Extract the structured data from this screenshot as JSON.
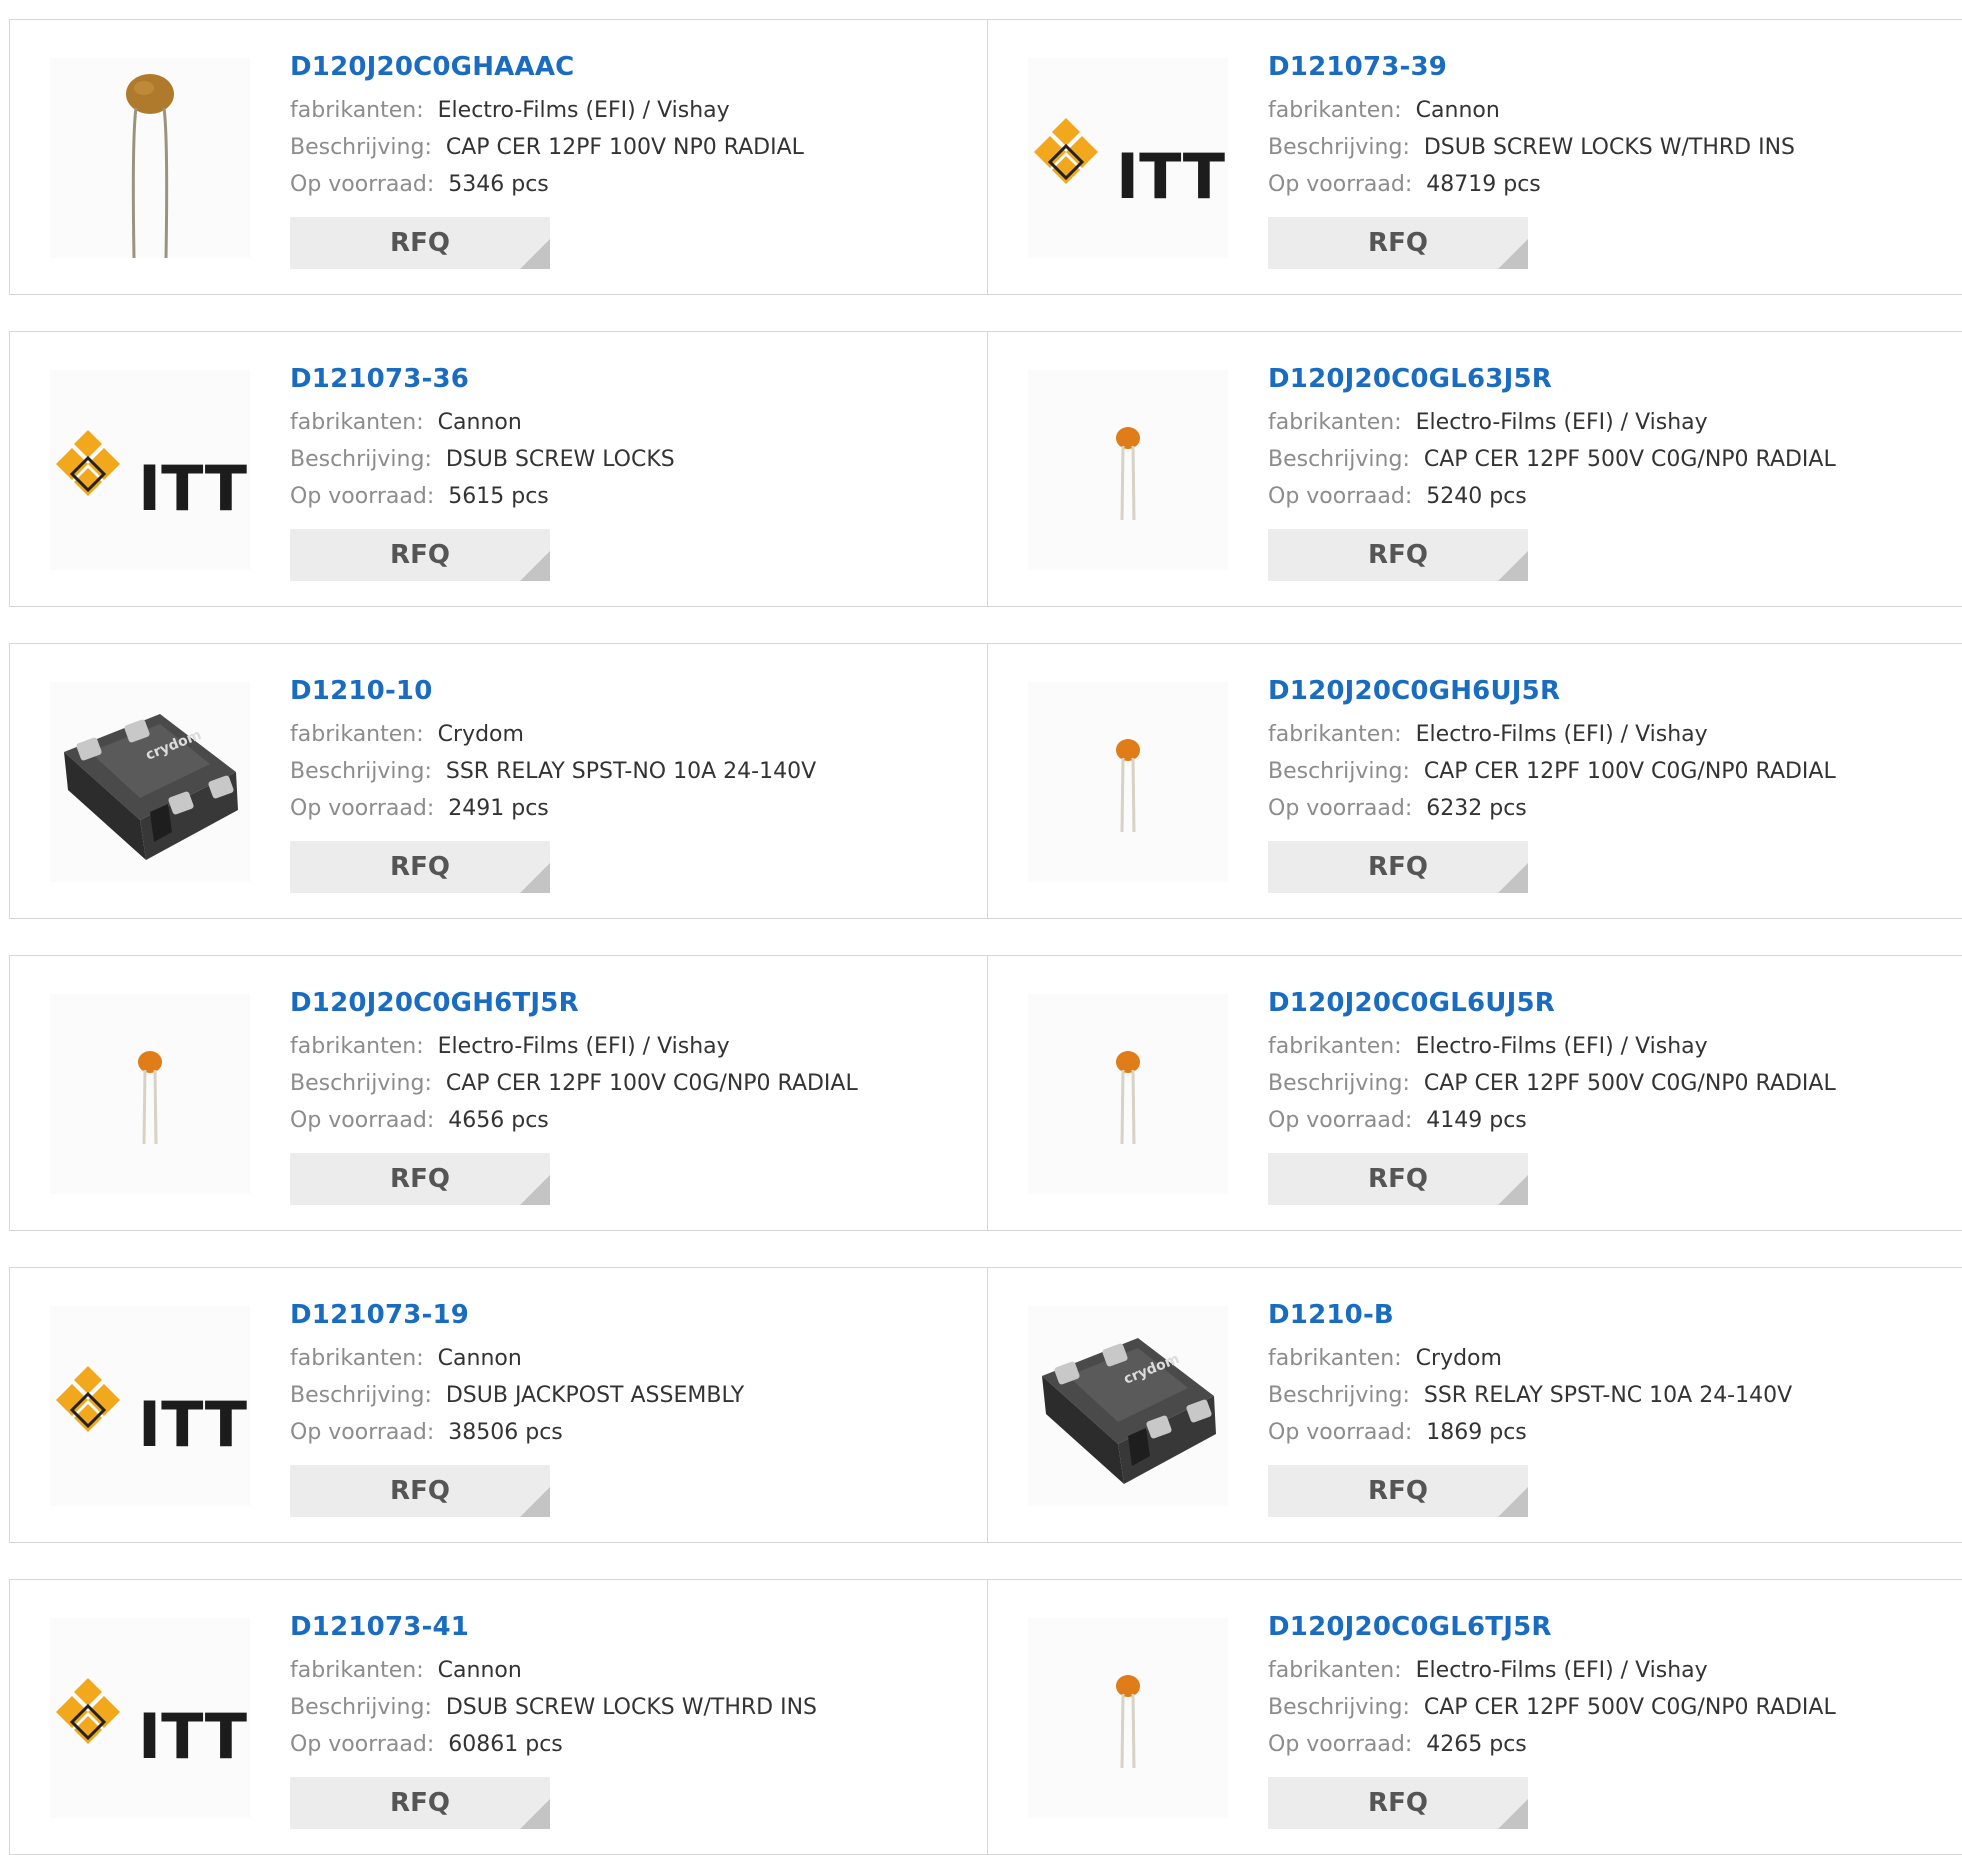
{
  "labels": {
    "manufacturer": "fabrikanten:",
    "description": "Beschrijving:",
    "stock": "Op voorraad:",
    "rfq": "RFQ"
  },
  "products": [
    {
      "pn": "D120J20C0GHAAAC",
      "mfr": "Electro-Films (EFI) / Vishay",
      "desc": "CAP CER 12PF 100V NP0 RADIAL",
      "stock": "5346 pcs",
      "image": "capacitor-large"
    },
    {
      "pn": "D121073-39",
      "mfr": "Cannon",
      "desc": "DSUB SCREW LOCKS W/THRD INS",
      "stock": "48719 pcs",
      "image": "itt-logo"
    },
    {
      "pn": "D121073-36",
      "mfr": "Cannon",
      "desc": "DSUB SCREW LOCKS",
      "stock": "5615 pcs",
      "image": "itt-logo"
    },
    {
      "pn": "D120J20C0GL63J5R",
      "mfr": "Electro-Films (EFI) / Vishay",
      "desc": "CAP CER 12PF 500V C0G/NP0 RADIAL",
      "stock": "5240 pcs",
      "image": "capacitor-small"
    },
    {
      "pn": "D1210-10",
      "mfr": "Crydom",
      "desc": "SSR RELAY SPST-NO 10A 24-140V",
      "stock": "2491 pcs",
      "image": "relay"
    },
    {
      "pn": "D120J20C0GH6UJ5R",
      "mfr": "Electro-Films (EFI) / Vishay",
      "desc": "CAP CER 12PF 100V C0G/NP0 RADIAL",
      "stock": "6232 pcs",
      "image": "capacitor-small"
    },
    {
      "pn": "D120J20C0GH6TJ5R",
      "mfr": "Electro-Films (EFI) / Vishay",
      "desc": "CAP CER 12PF 100V C0G/NP0 RADIAL",
      "stock": "4656 pcs",
      "image": "capacitor-small"
    },
    {
      "pn": "D120J20C0GL6UJ5R",
      "mfr": "Electro-Films (EFI) / Vishay",
      "desc": "CAP CER 12PF 500V C0G/NP0 RADIAL",
      "stock": "4149 pcs",
      "image": "capacitor-small"
    },
    {
      "pn": "D121073-19",
      "mfr": "Cannon",
      "desc": "DSUB JACKPOST ASSEMBLY",
      "stock": "38506 pcs",
      "image": "itt-logo"
    },
    {
      "pn": "D1210-B",
      "mfr": "Crydom",
      "desc": "SSR RELAY SPST-NC 10A 24-140V",
      "stock": "1869 pcs",
      "image": "relay"
    },
    {
      "pn": "D121073-41",
      "mfr": "Cannon",
      "desc": "DSUB SCREW LOCKS W/THRD INS",
      "stock": "60861 pcs",
      "image": "itt-logo"
    },
    {
      "pn": "D120J20C0GL6TJ5R",
      "mfr": "Electro-Films (EFI) / Vishay",
      "desc": "CAP CER 12PF 500V C0G/NP0 RADIAL",
      "stock": "4265 pcs",
      "image": "capacitor-small"
    }
  ],
  "logo_text": {
    "itt": "ITT",
    "crydom": "crydom"
  },
  "colors": {
    "link": "#1a6cc0",
    "label": "#8c8c8c",
    "value": "#333333",
    "button_bg": "#ececec",
    "itt_orange": "#f2a81d"
  }
}
